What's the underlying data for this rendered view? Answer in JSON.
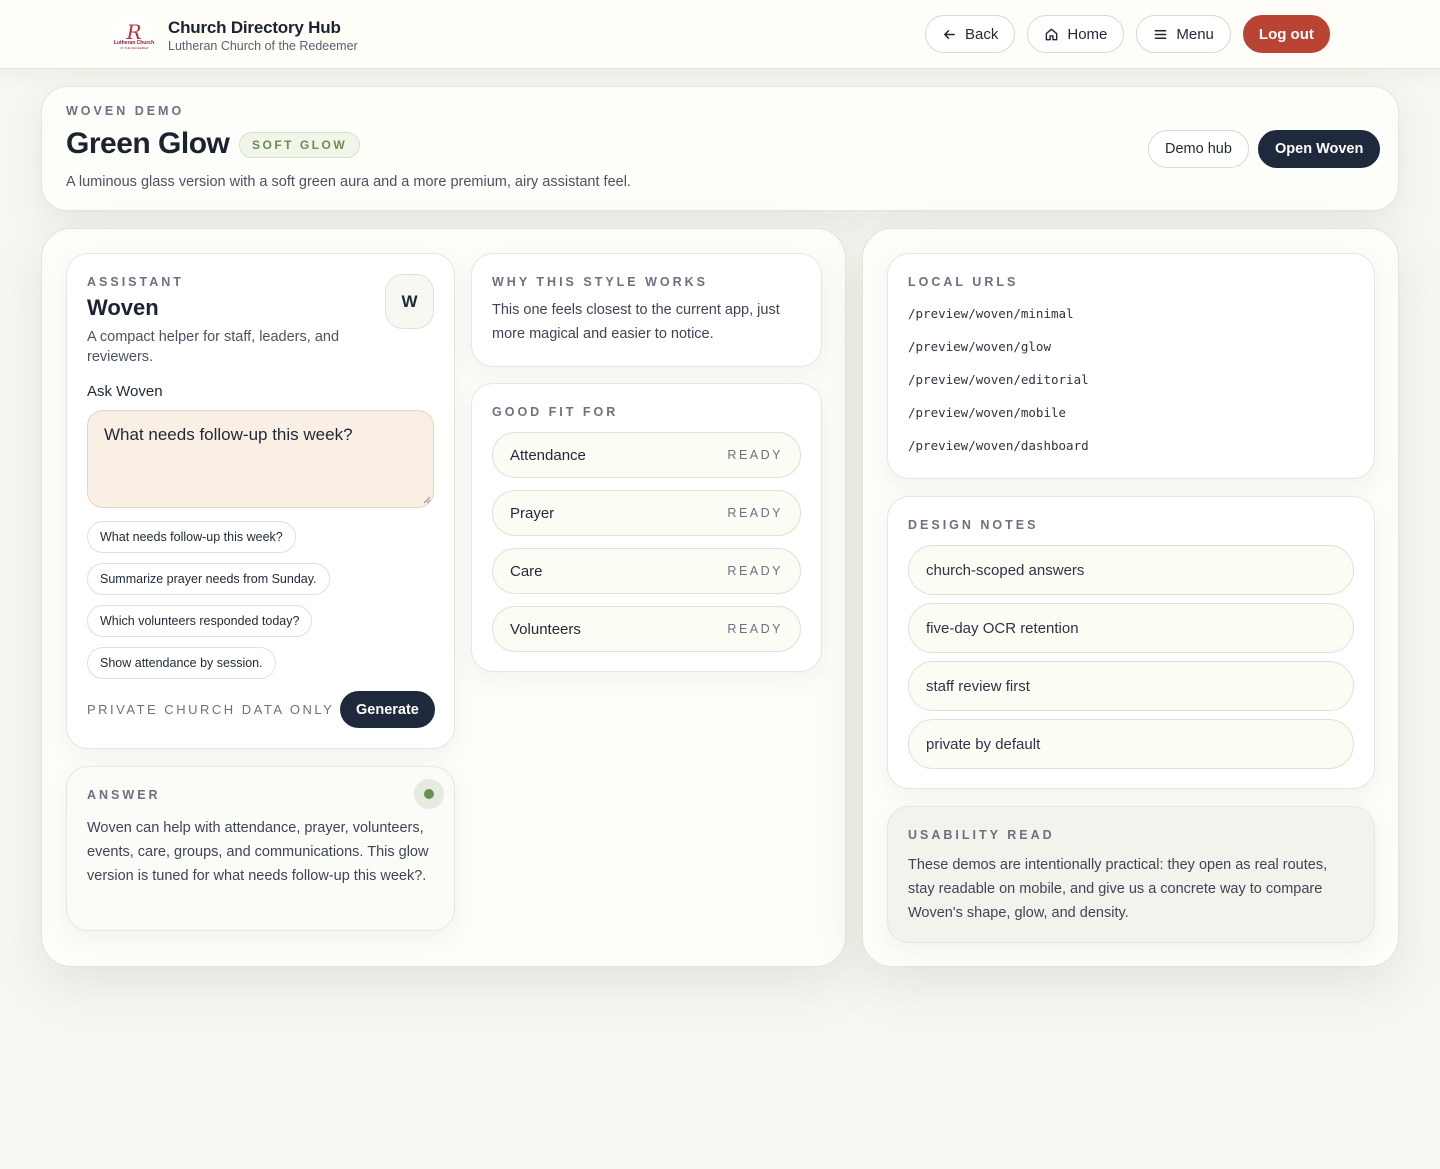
{
  "app": {
    "title": "Church Directory Hub",
    "subtitle": "Lutheran Church of the Redeemer",
    "logo": {
      "mark": "R",
      "line1": "Lutheran Church",
      "line2": "OF THE REDEEMER"
    }
  },
  "nav": {
    "back": "Back",
    "home": "Home",
    "menu": "Menu",
    "logout": "Log out"
  },
  "header": {
    "eyebrow": "WOVEN DEMO",
    "title": "Green Glow",
    "tag": "SOFT GLOW",
    "description": "A luminous glass version with a soft green aura and a more premium, airy assistant feel.",
    "demo_hub": "Demo hub",
    "open_woven": "Open Woven"
  },
  "assistant": {
    "eyebrow": "ASSISTANT",
    "title": "Woven",
    "description": "A compact helper for staff, leaders, and reviewers.",
    "avatar": "W",
    "ask_label": "Ask Woven",
    "query": "What needs follow-up this week?",
    "suggestions": [
      "What needs follow-up this week?",
      "Summarize prayer needs from Sunday.",
      "Which volunteers responded today?",
      "Show attendance by session."
    ],
    "private_note": "PRIVATE CHURCH DATA ONLY",
    "generate": "Generate"
  },
  "answer": {
    "eyebrow": "ANSWER",
    "text": "Woven can help with attendance, prayer, volunteers, events, care, groups, and communications. This glow version is tuned for what needs follow-up this week?."
  },
  "why": {
    "eyebrow": "WHY THIS STYLE WORKS",
    "text": "This one feels closest to the current app, just more magical and easier to notice."
  },
  "good_fit": {
    "eyebrow": "GOOD FIT FOR",
    "items": [
      {
        "label": "Attendance",
        "status": "READY"
      },
      {
        "label": "Prayer",
        "status": "READY"
      },
      {
        "label": "Care",
        "status": "READY"
      },
      {
        "label": "Volunteers",
        "status": "READY"
      }
    ]
  },
  "local_urls": {
    "eyebrow": "LOCAL URLS",
    "items": [
      "/preview/woven/minimal",
      "/preview/woven/glow",
      "/preview/woven/editorial",
      "/preview/woven/mobile",
      "/preview/woven/dashboard"
    ]
  },
  "design_notes": {
    "eyebrow": "DESIGN NOTES",
    "items": [
      "church-scoped answers",
      "five-day OCR retention",
      "staff review first",
      "private by default"
    ]
  },
  "usability": {
    "eyebrow": "USABILITY READ",
    "text": "These demos are intentionally practical: they open as real routes, stay readable on mobile, and give us a concrete way to compare Woven's shape, glow, and density."
  },
  "icons": {
    "back": "arrow-left-icon",
    "home": "home-icon",
    "menu": "menu-icon",
    "status": "status-dot-icon"
  },
  "colors": {
    "accent_green": "#6b8f52",
    "dark_navy": "#1e2a3c",
    "logout_red": "#b94434",
    "input_bg": "#f9efe4"
  }
}
